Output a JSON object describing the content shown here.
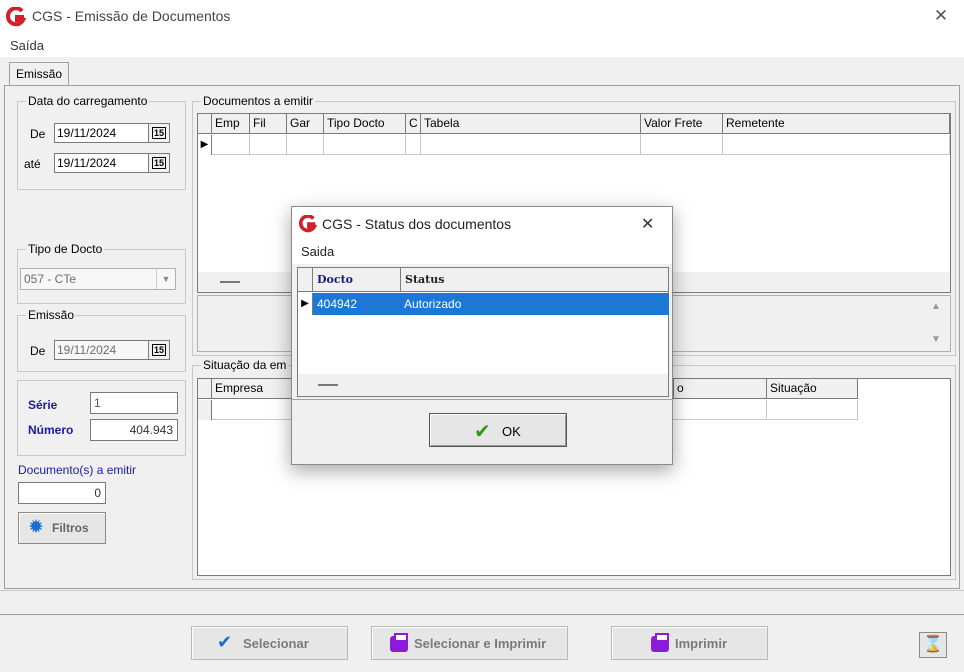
{
  "window": {
    "title": "CGS - Emissão de Documentos",
    "close_glyph": "✕"
  },
  "menu": {
    "saida": "Saída"
  },
  "tab": {
    "label": "Emissão"
  },
  "data_carregamento": {
    "legend": "Data do carregamento",
    "de_label": "De",
    "de_value": "19/11/2024",
    "ate_label": "até",
    "ate_value": "19/11/2024",
    "cal_glyph": "15"
  },
  "tipo_docto": {
    "legend": "Tipo de Docto",
    "value": "057 - CTe"
  },
  "emissao": {
    "legend": "Emissão",
    "de_label": "De",
    "de_value": "19/11/2024"
  },
  "serie": {
    "label": "Série",
    "value": "1"
  },
  "numero": {
    "label": "Número",
    "value": "404.943"
  },
  "docs_emitir": {
    "label": "Documento(s) a emitir",
    "value": "0"
  },
  "filtros_button": {
    "label": "Filtros"
  },
  "docs_grid": {
    "legend": "Documentos a emitir",
    "columns": [
      "Emp",
      "Fil",
      "Gar",
      "Tipo Docto",
      "C",
      "Tabela",
      "Valor Frete",
      "Remetente"
    ]
  },
  "situacao_grid": {
    "legend": "Situação da em",
    "columns": [
      "Empresa",
      "o",
      "Situação"
    ]
  },
  "buttons": {
    "selecionar": "Selecionar",
    "selecionar_imprimir": "Selecionar e Imprimir",
    "imprimir": "Imprimir"
  },
  "modal": {
    "title": "CGS - Status dos documentos",
    "close_glyph": "✕",
    "menu_saida": "Saida",
    "columns": [
      "Docto",
      "Status"
    ],
    "rows": [
      {
        "docto": "404942",
        "status": "Autorizado"
      }
    ],
    "ok_label": "OK"
  },
  "colors": {
    "selection": "#1c78d4",
    "accent_blue": "#1a1aa0",
    "printer_purple": "#8a1bd8",
    "logo_red": "#d0202a",
    "ok_green": "#2e9a1a"
  }
}
